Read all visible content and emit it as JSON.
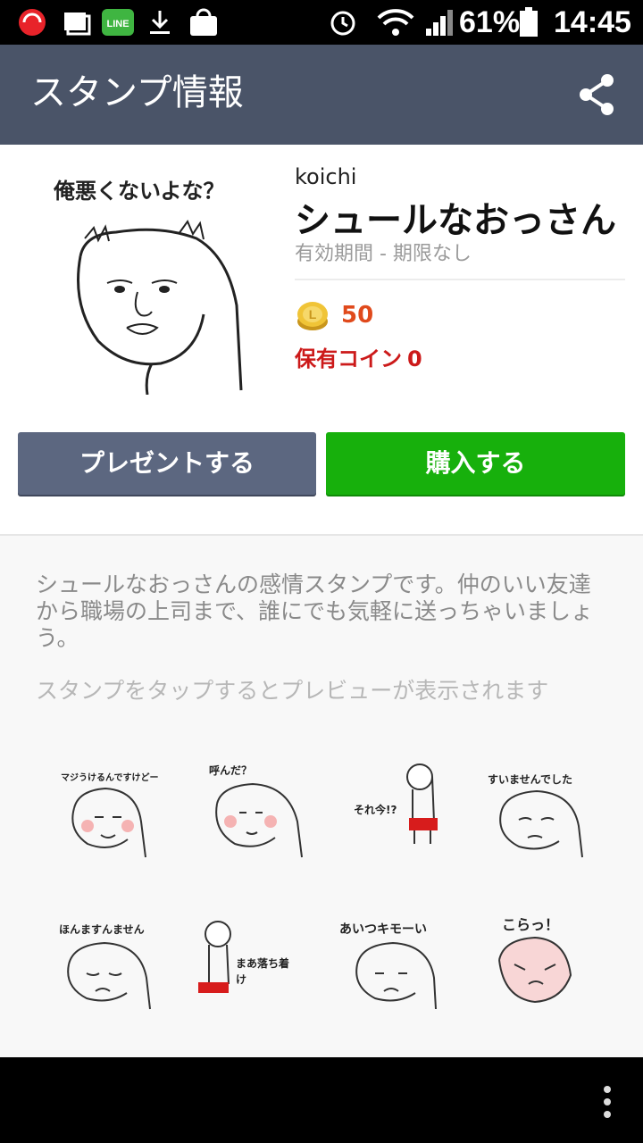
{
  "status_bar": {
    "battery_percent": "61%",
    "time": "14:45",
    "icons": [
      "trend-micro-icon",
      "photos-icon",
      "line-icon",
      "download-icon",
      "market-icon",
      "alarm-icon",
      "wifi-icon",
      "signal-icon",
      "battery-icon"
    ]
  },
  "app_bar": {
    "title": "スタンプ情報",
    "share_icon": "share-icon"
  },
  "sticker_pack": {
    "author": "koichi",
    "title": "シュールなおっさん",
    "validity": "有効期間 - 期限なし",
    "price": "50",
    "owned_label": "保有コイン",
    "owned_value": "0",
    "main_caption": "俺悪くないよな？"
  },
  "buttons": {
    "present": "プレゼントする",
    "buy": "購入する"
  },
  "description": "シュールなおっさんの感情スタンプです。仲のいい友達から職場の上司まで、誰にでも気軽に送っちゃいましょう。",
  "preview_hint": "スタンプをタップするとプレビューが表示されます",
  "stickers": [
    {
      "caption": "マジうけるんですけどー"
    },
    {
      "caption": "呼んだ？"
    },
    {
      "caption": "それ今!?"
    },
    {
      "caption": "すいませんでした"
    },
    {
      "caption": "ほんますんません"
    },
    {
      "caption": "まあ落ち着け"
    },
    {
      "caption": "あいつキモーい"
    },
    {
      "caption": "こらっ！"
    }
  ],
  "colors": {
    "app_bar": "#4a5468",
    "buy_button": "#17b00c",
    "present_button": "#5c6780",
    "price": "#e04a1c",
    "owned": "#cc1a1a"
  }
}
